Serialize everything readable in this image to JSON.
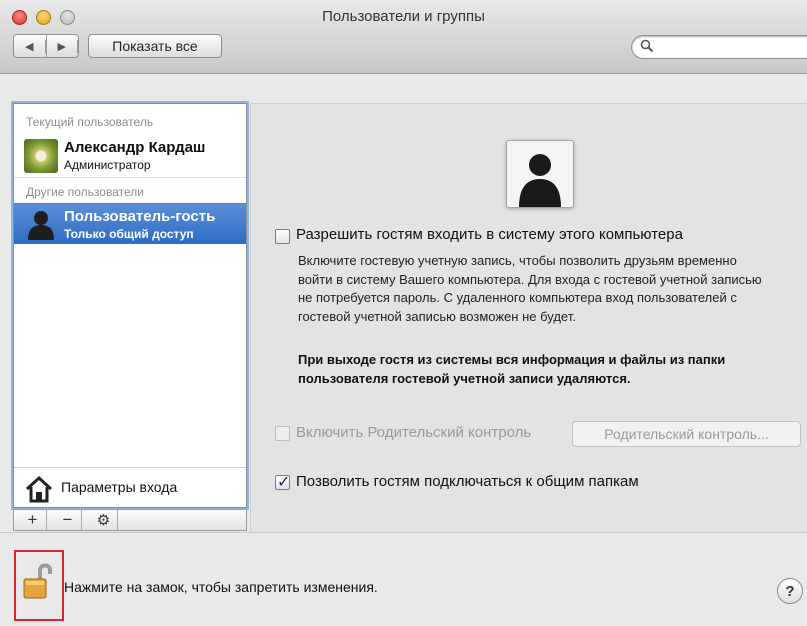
{
  "window": {
    "title": "Пользователи и группы"
  },
  "toolbar": {
    "back_icon": "chevron-left-icon",
    "forward_icon": "chevron-right-icon",
    "show_all_label": "Показать все",
    "search_icon": "search-icon"
  },
  "sidebar": {
    "current_header": "Текущий пользователь",
    "current_user": {
      "name": "Александр Кардаш",
      "role": "Администратор"
    },
    "others_header": "Другие пользователи",
    "guest_user": {
      "name": "Пользователь-гость",
      "role": "Только общий доступ"
    },
    "login_options_label": "Параметры входа",
    "tools": {
      "add": "+",
      "remove": "−",
      "gear": "⚙"
    }
  },
  "main": {
    "allow_guests_label": "Разрешить гостям входить в систему этого компьютера",
    "allow_guests_checked": false,
    "description": "Включите гостевую учетную запись, чтобы позволить друзьям временно войти в систему Вашего компьютера. Для входа с гостевой учетной записью не потребуется пароль. С удаленного компьютера вход пользователей с гостевой учетной записью возможен не будет.",
    "warning": "При выходе гостя из системы вся информация и файлы из папки пользователя гостевой учетной записи удаляются.",
    "parental_label": "Включить Родительский контроль",
    "parental_checked": false,
    "parental_button": "Родительский контроль...",
    "shared_folders_label": "Позволить гостям подключаться к общим папкам",
    "shared_folders_checked": true
  },
  "footer": {
    "lock_text": "Нажмите на замок, чтобы запретить изменения.",
    "help_label": "?"
  },
  "colors": {
    "selection": "#3b76cc",
    "focus_ring": "#8db5e6",
    "lock_highlight": "#d8262c"
  }
}
